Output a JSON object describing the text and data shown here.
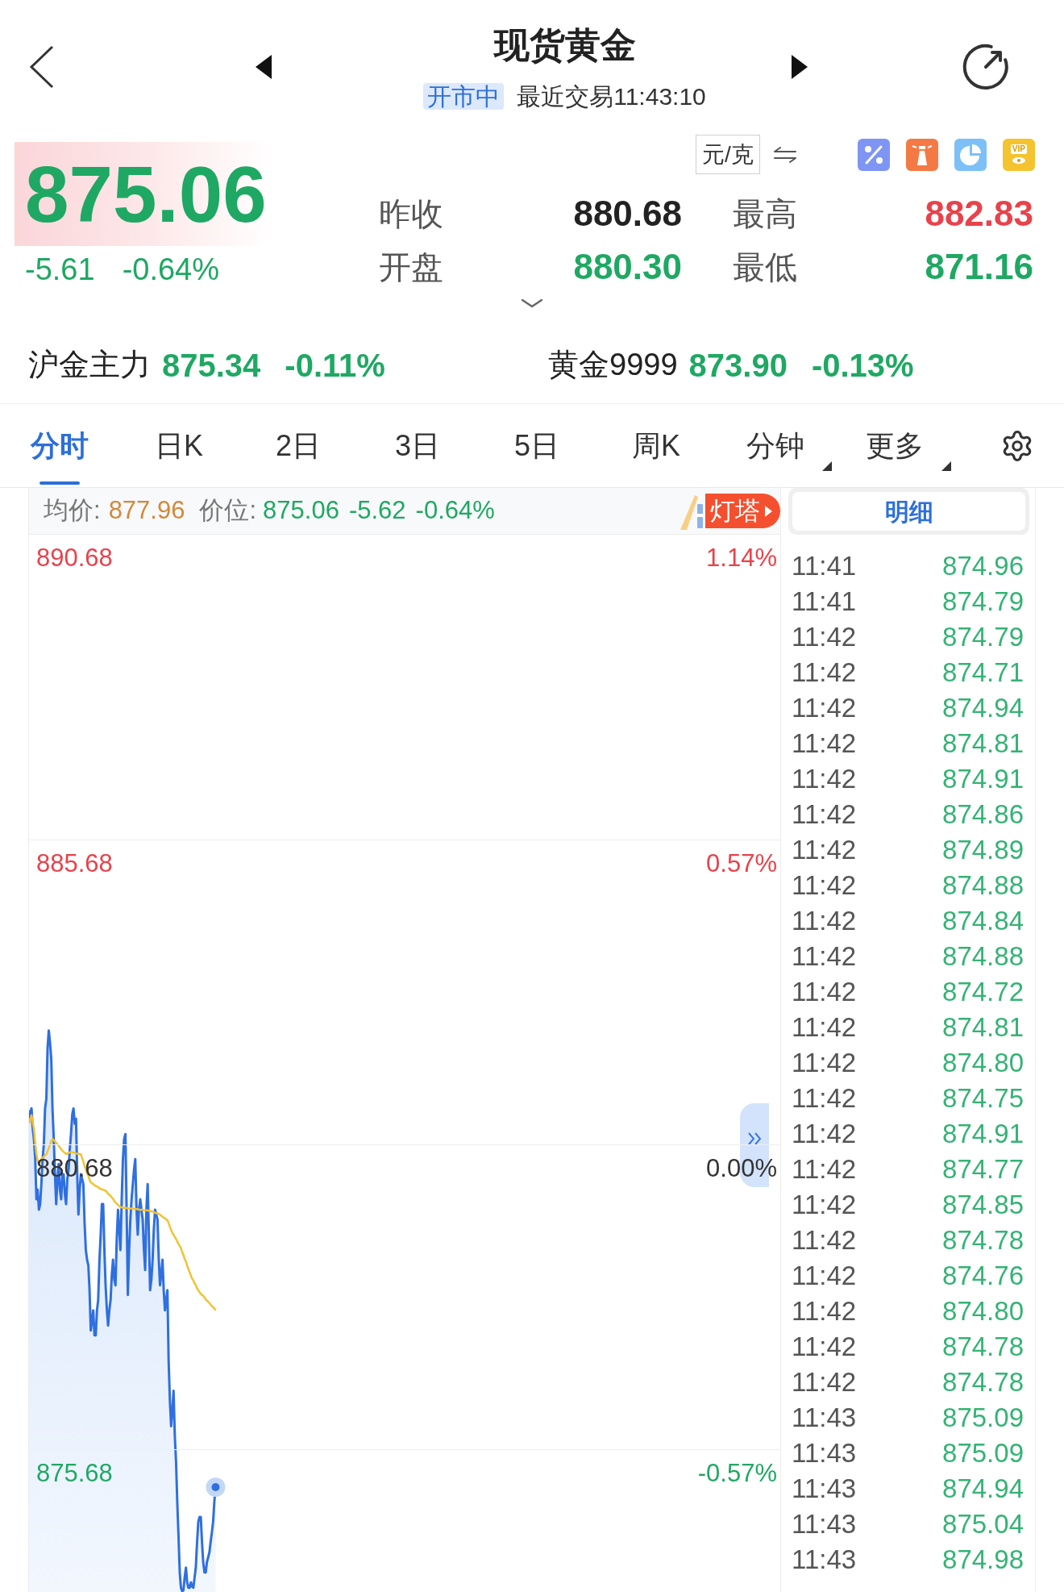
{
  "header": {
    "title": "现货黄金",
    "status": "开市中",
    "last_trade": "最近交易11:43:10"
  },
  "quote": {
    "price": "875.06",
    "change": "-5.61",
    "change_percent": "-0.64%",
    "color": "#1fa863",
    "unit": "元/克",
    "vip_label": "VIP"
  },
  "stats": [
    {
      "label": "昨收",
      "value": "880.68",
      "color": "#222222"
    },
    {
      "label": "最高",
      "value": "882.83",
      "color": "#e8424b"
    },
    {
      "label": "开盘",
      "value": "880.30",
      "color": "#1fa863"
    },
    {
      "label": "最低",
      "value": "871.16",
      "color": "#1fa863"
    }
  ],
  "related": [
    {
      "name": "沪金主力",
      "price": "875.34",
      "change": "-0.11%",
      "color": "#1fa863"
    },
    {
      "name": "黄金9999",
      "price": "873.90",
      "change": "-0.13%",
      "color": "#1fa863"
    }
  ],
  "tabs": [
    {
      "label": "分时",
      "selected": true,
      "dropdown": false
    },
    {
      "label": "日K",
      "selected": false,
      "dropdown": false
    },
    {
      "label": "2日",
      "selected": false,
      "dropdown": false
    },
    {
      "label": "3日",
      "selected": false,
      "dropdown": false
    },
    {
      "label": "5日",
      "selected": false,
      "dropdown": false
    },
    {
      "label": "周K",
      "selected": false,
      "dropdown": false
    },
    {
      "label": "分钟",
      "selected": false,
      "dropdown": true
    },
    {
      "label": "更多",
      "selected": false,
      "dropdown": true
    }
  ],
  "chart": {
    "average_label": "均价:",
    "average": "877.96",
    "price_label": "价位:",
    "price": "875.06",
    "change": "-5.62",
    "change_percent": "-0.64%",
    "beacon": "灯塔",
    "levels": [
      {
        "percent": "1.14%",
        "color": "#e8424b"
      },
      {
        "percent": "0.57%",
        "color": "#e8424b"
      },
      {
        "percent": "0.00%",
        "color": "#333333"
      },
      {
        "percent": "-0.57%",
        "color": "#1fa863"
      }
    ],
    "chart_data": {
      "type": "area",
      "ylim": [
        873.34,
        890.68
      ],
      "grid": true,
      "yticks": [
        {
          "value": 890.68,
          "label": "890.68"
        },
        {
          "value": 885.68,
          "label": "885.68"
        },
        {
          "value": 880.68,
          "label": "880.68"
        },
        {
          "value": 875.68,
          "label": "875.68"
        }
      ],
      "series": [
        {
          "type": "area",
          "color": "#2f6fe0",
          "values": [
            881.06,
            881.22,
            881.27,
            880.94,
            880.77,
            880.44,
            879.78,
            879.94,
            879.61,
            879.7,
            880.03,
            880.44,
            880.69,
            881.27,
            881.43,
            882.26,
            882.55,
            882.34,
            882.09,
            881.27,
            880.77,
            880.19,
            879.7,
            880.11,
            880.36,
            879.94,
            879.78,
            880.19,
            880.19,
            879.86,
            879.7,
            880.11,
            880.27,
            880.61,
            880.85,
            881.18,
            881.27,
            881.02,
            881.1,
            880.19,
            879.53,
            879.94,
            880.19,
            880.11,
            880.03,
            879.37,
            878.95,
            878.79,
            878.7,
            878.29,
            877.63,
            877.79,
            877.96,
            877.55,
            877.55,
            877.96,
            878.13,
            878.79,
            879.2,
            879.7,
            879.7,
            878.95,
            878.37,
            877.96,
            877.71,
            877.96,
            878.13,
            878.54,
            878.79,
            878.46,
            878.37,
            879.12,
            879.61,
            879.28,
            878.95,
            879.78,
            880.44,
            880.77,
            880.85,
            879.61,
            878.21,
            878.95,
            879.45,
            879.78,
            880.03,
            880.27,
            880.44,
            879.61,
            879.2,
            879.61,
            879.78,
            879.61,
            879.45,
            878.95,
            878.62,
            879.61,
            880.03,
            879.2,
            878.29,
            878.46,
            878.79,
            879.28,
            879.61,
            879.53,
            879.45,
            878.79,
            878.37,
            878.54,
            878.79,
            878.29,
            877.96,
            878.13,
            878.29,
            877.13,
            876.47,
            876.06,
            876.31,
            876.64,
            875.89,
            875.48,
            874.82,
            874.24,
            873.66,
            873.41,
            873.35,
            873.37,
            873.58,
            873.74,
            873.5,
            873.41,
            873.41,
            873.5,
            873.43,
            873.41,
            873.58,
            873.74,
            874.16,
            874.49,
            874.57,
            874.57,
            874.16,
            873.83,
            873.66,
            873.66,
            873.83,
            873.91,
            873.99,
            874.16,
            874.32,
            874.49,
            874.82,
            875.06,
            null,
            null,
            null,
            null,
            null,
            null,
            null,
            null,
            null,
            null,
            null,
            null,
            null,
            null,
            null,
            null,
            null,
            null,
            null,
            null,
            null,
            null,
            null,
            null,
            null,
            null,
            null,
            null,
            null,
            null,
            null,
            null,
            null,
            null,
            null,
            null,
            null,
            null,
            null,
            null,
            null,
            null,
            null,
            null,
            null,
            null,
            null,
            null,
            null,
            null,
            null,
            null,
            null,
            null,
            null,
            null,
            null,
            null,
            null,
            null,
            null,
            null,
            null,
            null,
            null,
            null,
            null,
            null,
            null,
            null,
            null,
            null,
            null,
            null,
            null,
            null,
            null,
            null,
            null,
            null,
            null,
            null,
            null,
            null,
            null,
            null,
            null,
            null,
            null,
            null,
            null,
            null,
            null,
            null,
            null,
            null,
            null,
            null,
            null,
            null,
            null,
            null,
            null,
            null,
            null,
            null,
            null,
            null,
            null,
            null,
            null,
            null,
            null,
            null,
            null,
            null,
            null,
            null,
            null,
            null,
            null,
            null,
            null,
            null,
            null,
            null,
            null,
            null,
            null,
            null,
            null,
            null,
            null,
            null,
            null,
            null,
            null,
            null,
            null,
            null,
            null,
            null,
            null,
            null,
            null,
            null,
            null,
            null,
            null,
            null,
            null,
            null,
            null,
            null,
            null,
            null,
            null,
            null,
            null,
            null,
            null,
            null,
            null,
            null,
            null,
            null,
            null,
            null,
            null,
            null,
            null,
            null,
            null,
            null,
            null,
            null,
            null,
            null,
            null,
            null,
            null,
            null,
            null,
            null,
            null,
            null,
            null,
            null,
            null,
            null,
            null,
            null,
            null,
            null,
            null,
            null,
            null,
            null,
            null,
            null,
            null,
            null,
            null,
            null,
            null,
            null,
            null,
            null,
            null,
            null,
            null,
            null,
            null,
            null,
            null,
            null,
            null,
            null,
            null,
            null,
            null,
            null,
            null,
            null,
            null,
            null,
            null,
            null,
            null,
            null,
            null,
            null,
            null,
            null,
            null,
            null,
            null,
            null,
            null,
            null,
            null,
            null,
            null,
            null,
            null,
            null,
            null,
            null,
            null,
            null,
            null,
            null,
            null,
            null,
            null,
            null,
            null,
            null,
            null,
            null,
            null,
            null,
            null,
            null,
            null,
            null,
            null,
            null,
            null,
            null,
            null,
            null,
            null,
            null,
            null,
            null,
            null,
            null,
            null,
            null,
            null,
            null,
            null,
            null,
            null,
            null,
            null,
            null,
            null,
            null,
            null,
            null,
            null,
            null,
            null,
            null,
            null,
            null,
            null,
            null,
            null,
            null,
            null,
            null,
            null,
            null,
            null,
            null,
            null,
            null,
            null,
            null,
            null,
            null,
            null,
            null,
            null,
            null,
            null,
            null,
            null,
            null,
            null,
            null,
            null,
            null,
            null,
            null,
            null,
            null,
            null,
            null,
            null,
            null,
            null,
            null,
            null,
            null,
            null,
            null,
            null,
            null,
            null,
            null,
            null,
            null,
            null,
            null,
            null,
            null,
            null,
            null,
            null,
            null,
            null,
            null,
            null,
            null,
            null,
            null,
            null,
            null,
            null,
            null,
            null,
            null,
            null,
            null,
            null,
            null,
            null,
            null,
            null,
            null,
            null,
            null,
            null,
            null,
            null,
            null,
            null,
            null,
            null,
            null,
            null,
            null,
            null,
            null,
            null,
            null,
            null,
            null,
            null,
            null,
            null,
            null,
            null,
            null,
            null,
            null,
            null,
            null,
            null,
            null,
            null,
            null,
            null,
            null,
            null,
            null,
            null,
            null,
            null,
            null,
            null,
            null,
            null,
            null,
            null,
            null,
            null,
            null,
            null,
            null,
            null,
            null,
            null,
            null,
            null,
            null,
            null,
            null,
            null,
            null,
            null,
            null,
            null,
            null,
            null,
            null,
            null,
            null,
            null,
            null,
            null,
            null,
            null,
            null,
            null,
            null,
            null,
            null,
            null,
            null,
            null,
            null,
            null
          ]
        },
        {
          "type": "line",
          "color": "#f2c232",
          "values": [
            881.02,
            881.1,
            881.16,
            881.05,
            880.93,
            880.7,
            880.52,
            880.42,
            880.35,
            880.4,
            880.44,
            880.46,
            880.48,
            880.5,
            880.52,
            880.57,
            880.62,
            880.68,
            880.73,
            880.77,
            880.75,
            880.73,
            880.71,
            880.68,
            880.66,
            880.63,
            880.6,
            880.58,
            880.56,
            880.54,
            880.52,
            880.53,
            880.54,
            880.55,
            880.56,
            880.55,
            880.55,
            880.54,
            880.53,
            880.53,
            880.53,
            880.52,
            880.52,
            880.45,
            880.4,
            880.32,
            880.27,
            880.21,
            880.17,
            880.1,
            880.06,
            880.04,
            880.03,
            880.01,
            880.0,
            879.99,
            879.98,
            879.96,
            879.95,
            879.94,
            879.94,
            879.93,
            879.92,
            879.9,
            879.87,
            879.86,
            879.84,
            879.81,
            879.79,
            879.75,
            879.73,
            879.71,
            879.69,
            879.67,
            879.65,
            879.65,
            879.64,
            879.64,
            879.64,
            879.64,
            879.63,
            879.63,
            879.63,
            879.63,
            879.63,
            879.62,
            879.62,
            879.62,
            879.62,
            879.61,
            879.61,
            879.61,
            879.61,
            879.6,
            879.6,
            879.6,
            879.6,
            879.59,
            879.59,
            879.58,
            879.58,
            879.57,
            879.56,
            879.55,
            879.55,
            879.54,
            879.53,
            879.51,
            879.5,
            879.48,
            879.47,
            879.45,
            879.44,
            879.39,
            879.33,
            879.28,
            879.23,
            879.2,
            879.16,
            879.13,
            879.09,
            879.05,
            879.01,
            878.98,
            878.91,
            878.87,
            878.8,
            878.76,
            878.69,
            878.64,
            878.58,
            878.53,
            878.48,
            878.45,
            878.4,
            878.37,
            878.32,
            878.29,
            878.26,
            878.23,
            878.21,
            878.2,
            878.17,
            878.14,
            878.12,
            878.1,
            878.08,
            878.05,
            878.03,
            878.01,
            877.99,
            877.96,
            null,
            null,
            null,
            null,
            null,
            null,
            null,
            null,
            null,
            null,
            null,
            null,
            null,
            null,
            null,
            null,
            null,
            null,
            null,
            null,
            null,
            null,
            null,
            null,
            null,
            null,
            null,
            null,
            null,
            null,
            null,
            null,
            null,
            null,
            null,
            null,
            null,
            null,
            null,
            null,
            null,
            null,
            null,
            null,
            null,
            null,
            null,
            null,
            null,
            null,
            null,
            null,
            null,
            null,
            null,
            null,
            null,
            null,
            null,
            null,
            null,
            null,
            null,
            null,
            null,
            null,
            null,
            null,
            null,
            null,
            null,
            null,
            null,
            null,
            null,
            null,
            null,
            null,
            null,
            null,
            null,
            null,
            null,
            null,
            null,
            null,
            null,
            null,
            null,
            null,
            null,
            null,
            null,
            null,
            null,
            null,
            null,
            null,
            null,
            null,
            null,
            null,
            null,
            null,
            null,
            null,
            null,
            null,
            null,
            null,
            null,
            null,
            null,
            null,
            null,
            null,
            null,
            null,
            null,
            null,
            null,
            null,
            null,
            null,
            null,
            null,
            null,
            null,
            null,
            null,
            null,
            null,
            null,
            null,
            null,
            null,
            null,
            null,
            null,
            null,
            null,
            null,
            null,
            null,
            null,
            null,
            null,
            null,
            null,
            null,
            null,
            null,
            null,
            null,
            null,
            null,
            null,
            null,
            null,
            null,
            null,
            null,
            null,
            null,
            null,
            null,
            null,
            null,
            null,
            null,
            null,
            null,
            null,
            null,
            null,
            null,
            null,
            null,
            null,
            null,
            null,
            null,
            null,
            null,
            null,
            null,
            null,
            null,
            null,
            null,
            null,
            null,
            null,
            null,
            null,
            null,
            null,
            null,
            null,
            null,
            null,
            null,
            null,
            null,
            null,
            null,
            null,
            null,
            null,
            null,
            null,
            null,
            null,
            null,
            null,
            null,
            null,
            null,
            null,
            null,
            null,
            null,
            null,
            null,
            null,
            null,
            null,
            null,
            null,
            null,
            null,
            null,
            null,
            null,
            null,
            null,
            null,
            null,
            null,
            null,
            null,
            null,
            null,
            null,
            null,
            null,
            null,
            null,
            null,
            null,
            null,
            null,
            null,
            null,
            null,
            null,
            null,
            null,
            null,
            null,
            null,
            null,
            null,
            null,
            null,
            null,
            null,
            null,
            null,
            null,
            null,
            null,
            null,
            null,
            null,
            null,
            null,
            null,
            null,
            null,
            null,
            null,
            null,
            null,
            null,
            null,
            null,
            null,
            null,
            null,
            null,
            null,
            null,
            null,
            null,
            null,
            null,
            null,
            null,
            null,
            null,
            null,
            null,
            null,
            null,
            null,
            null,
            null,
            null,
            null,
            null,
            null,
            null,
            null,
            null,
            null,
            null,
            null,
            null,
            null,
            null,
            null,
            null,
            null,
            null,
            null,
            null,
            null,
            null,
            null,
            null,
            null,
            null,
            null,
            null,
            null,
            null,
            null,
            null,
            null,
            null,
            null,
            null,
            null,
            null,
            null,
            null,
            null,
            null,
            null,
            null,
            null,
            null,
            null,
            null,
            null,
            null,
            null,
            null,
            null,
            null,
            null,
            null,
            null,
            null,
            null,
            null,
            null,
            null,
            null,
            null,
            null,
            null,
            null,
            null,
            null,
            null,
            null,
            null,
            null,
            null,
            null,
            null,
            null,
            null,
            null,
            null,
            null,
            null,
            null,
            null,
            null,
            null,
            null,
            null,
            null,
            null,
            null,
            null,
            null,
            null,
            null,
            null,
            null,
            null,
            null,
            null,
            null,
            null,
            null,
            null,
            null,
            null,
            null,
            null,
            null,
            null,
            null,
            null,
            null,
            null,
            null,
            null,
            null,
            null,
            null,
            null,
            null,
            null,
            null,
            null,
            null,
            null,
            null,
            null,
            null,
            null,
            null,
            null,
            null,
            null,
            null,
            null,
            null,
            null,
            null,
            null,
            null,
            null,
            null,
            null,
            null,
            null,
            null,
            null,
            null,
            null
          ]
        }
      ]
    }
  },
  "details": {
    "title": "明细",
    "rows": [
      {
        "time": "11:41",
        "price": "874.96"
      },
      {
        "time": "11:41",
        "price": "874.79"
      },
      {
        "time": "11:42",
        "price": "874.79"
      },
      {
        "time": "11:42",
        "price": "874.71"
      },
      {
        "time": "11:42",
        "price": "874.94"
      },
      {
        "time": "11:42",
        "price": "874.81"
      },
      {
        "time": "11:42",
        "price": "874.91"
      },
      {
        "time": "11:42",
        "price": "874.86"
      },
      {
        "time": "11:42",
        "price": "874.89"
      },
      {
        "time": "11:42",
        "price": "874.88"
      },
      {
        "time": "11:42",
        "price": "874.84"
      },
      {
        "time": "11:42",
        "price": "874.88"
      },
      {
        "time": "11:42",
        "price": "874.72"
      },
      {
        "time": "11:42",
        "price": "874.81"
      },
      {
        "time": "11:42",
        "price": "874.80"
      },
      {
        "time": "11:42",
        "price": "874.75"
      },
      {
        "time": "11:42",
        "price": "874.91"
      },
      {
        "time": "11:42",
        "price": "874.77"
      },
      {
        "time": "11:42",
        "price": "874.85"
      },
      {
        "time": "11:42",
        "price": "874.78"
      },
      {
        "time": "11:42",
        "price": "874.76"
      },
      {
        "time": "11:42",
        "price": "874.80"
      },
      {
        "time": "11:42",
        "price": "874.78"
      },
      {
        "time": "11:42",
        "price": "874.78"
      },
      {
        "time": "11:43",
        "price": "875.09"
      },
      {
        "time": "11:43",
        "price": "875.09"
      },
      {
        "time": "11:43",
        "price": "874.94"
      },
      {
        "time": "11:43",
        "price": "875.04"
      },
      {
        "time": "11:43",
        "price": "874.98"
      }
    ]
  }
}
